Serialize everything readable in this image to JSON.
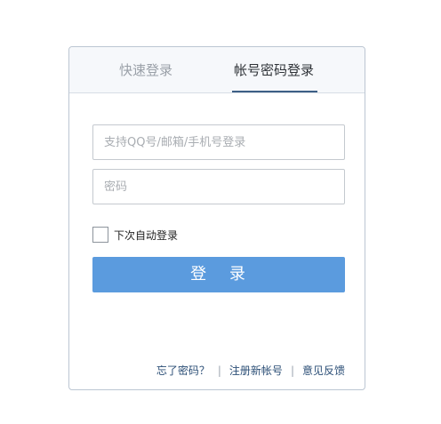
{
  "tabs": {
    "quick_login": "快速登录",
    "password_login": "帐号密码登录",
    "active": "password_login"
  },
  "form": {
    "account_placeholder": "支持QQ号/邮箱/手机号登录",
    "account_value": "",
    "password_placeholder": "密码",
    "password_value": "",
    "remember_label": "下次自动登录",
    "remember_checked": false,
    "login_button": "登 录"
  },
  "footer": {
    "forgot_password": "忘了密码？",
    "separator": "|",
    "register": "注册新帐号",
    "feedback": "意见反馈"
  },
  "colors": {
    "button_bg": "#5b9bde",
    "tab_active_underline": "#3d5f86",
    "link": "#2b4e76"
  }
}
